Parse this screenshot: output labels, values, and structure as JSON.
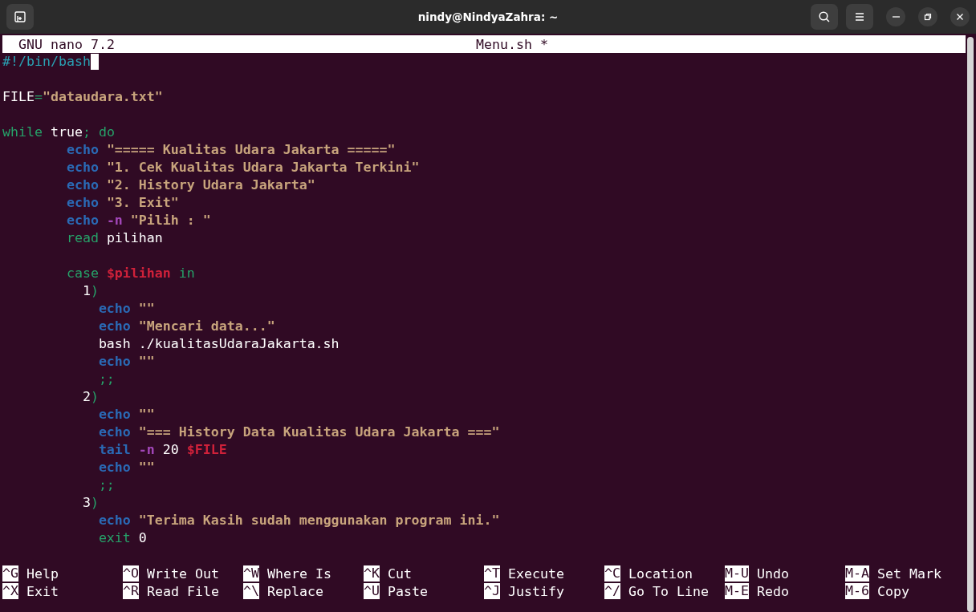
{
  "window": {
    "title": "nindy@NindyaZahra: ~"
  },
  "editor": {
    "app": "GNU nano 7.2",
    "filename": "Menu.sh *"
  },
  "lines": [
    {
      "cursor": true,
      "segments": [
        {
          "kind": "comment",
          "text": "#!/bin/bash"
        }
      ]
    },
    {
      "cursor": false
    },
    {
      "cursor": false,
      "segments": [
        {
          "kind": "plain",
          "text": "FILE"
        },
        {
          "kind": "punct",
          "text": "="
        },
        {
          "kind": "string",
          "text": "\"dataudara.txt\""
        }
      ]
    },
    {
      "cursor": false
    },
    {
      "cursor": false,
      "segments": [
        {
          "kind": "keyword",
          "text": "while"
        },
        {
          "kind": "plain",
          "text": " true"
        },
        {
          "kind": "keyword",
          "text": "; do"
        }
      ]
    },
    {
      "cursor": false,
      "segments": [
        {
          "kind": "builtin",
          "text": "        echo"
        },
        {
          "kind": "string",
          "text": " \"===== Kualitas Udara Jakarta =====\""
        }
      ]
    },
    {
      "cursor": false,
      "segments": [
        {
          "kind": "builtin",
          "text": "        echo"
        },
        {
          "kind": "string",
          "text": " \"1. Cek Kualitas Udara Jakarta Terkini\""
        }
      ]
    },
    {
      "cursor": false,
      "segments": [
        {
          "kind": "builtin",
          "text": "        echo"
        },
        {
          "kind": "string",
          "text": " \"2. History Udara Jakarta\""
        }
      ]
    },
    {
      "cursor": false,
      "segments": [
        {
          "kind": "builtin",
          "text": "        echo"
        },
        {
          "kind": "string",
          "text": " \"3. Exit\""
        }
      ]
    },
    {
      "cursor": false,
      "segments": [
        {
          "kind": "builtin",
          "text": "        echo"
        },
        {
          "kind": "option",
          "text": " -n"
        },
        {
          "kind": "string",
          "text": " \"Pilih : \""
        }
      ]
    },
    {
      "cursor": false,
      "segments": [
        {
          "kind": "keyword",
          "text": "        read"
        },
        {
          "kind": "plain",
          "text": " pilihan"
        }
      ]
    },
    {
      "cursor": false
    },
    {
      "cursor": false,
      "segments": [
        {
          "kind": "keyword",
          "text": "        case"
        },
        {
          "kind": "variable",
          "text": " $pilihan"
        },
        {
          "kind": "keyword",
          "text": " in"
        }
      ]
    },
    {
      "cursor": false,
      "segments": [
        {
          "kind": "plain",
          "text": "          1"
        },
        {
          "kind": "punct",
          "text": ")"
        }
      ]
    },
    {
      "cursor": false,
      "segments": [
        {
          "kind": "builtin",
          "text": "            echo"
        },
        {
          "kind": "string",
          "text": " \"\""
        }
      ]
    },
    {
      "cursor": false,
      "segments": [
        {
          "kind": "builtin",
          "text": "            echo"
        },
        {
          "kind": "string",
          "text": " \"Mencari data...\""
        }
      ]
    },
    {
      "cursor": false,
      "segments": [
        {
          "kind": "plain",
          "text": "            bash ./kualitasUdaraJakarta.sh"
        }
      ]
    },
    {
      "cursor": false,
      "segments": [
        {
          "kind": "builtin",
          "text": "            echo"
        },
        {
          "kind": "string",
          "text": " \"\""
        }
      ]
    },
    {
      "cursor": false,
      "segments": [
        {
          "kind": "punct",
          "text": "            ;;"
        }
      ]
    },
    {
      "cursor": false,
      "segments": [
        {
          "kind": "plain",
          "text": "          2"
        },
        {
          "kind": "punct",
          "text": ")"
        }
      ]
    },
    {
      "cursor": false,
      "segments": [
        {
          "kind": "builtin",
          "text": "            echo"
        },
        {
          "kind": "string",
          "text": " \"\""
        }
      ]
    },
    {
      "cursor": false,
      "segments": [
        {
          "kind": "builtin",
          "text": "            echo"
        },
        {
          "kind": "string",
          "text": " \"=== History Data Kualitas Udara Jakarta ===\""
        }
      ]
    },
    {
      "cursor": false,
      "segments": [
        {
          "kind": "builtin",
          "text": "            tail"
        },
        {
          "kind": "option",
          "text": " -n"
        },
        {
          "kind": "plain",
          "text": " 20"
        },
        {
          "kind": "variable",
          "text": " $FILE"
        }
      ]
    },
    {
      "cursor": false,
      "segments": [
        {
          "kind": "builtin",
          "text": "            echo"
        },
        {
          "kind": "string",
          "text": " \"\""
        }
      ]
    },
    {
      "cursor": false,
      "segments": [
        {
          "kind": "punct",
          "text": "            ;;"
        }
      ]
    },
    {
      "cursor": false,
      "segments": [
        {
          "kind": "plain",
          "text": "          3"
        },
        {
          "kind": "punct",
          "text": ")"
        }
      ]
    },
    {
      "cursor": false,
      "segments": [
        {
          "kind": "builtin",
          "text": "            echo"
        },
        {
          "kind": "string",
          "text": " \"Terima Kasih sudah menggunakan program ini.\""
        }
      ]
    },
    {
      "cursor": false,
      "segments": [
        {
          "kind": "keyword",
          "text": "            exit"
        },
        {
          "kind": "plain",
          "text": " 0"
        }
      ]
    }
  ],
  "shortcuts": [
    [
      {
        "key": "^G",
        "label": "Help"
      },
      {
        "key": "^X",
        "label": "Exit"
      }
    ],
    [
      {
        "key": "^O",
        "label": "Write Out"
      },
      {
        "key": "^R",
        "label": "Read File"
      }
    ],
    [
      {
        "key": "^W",
        "label": "Where Is"
      },
      {
        "key": "^\\",
        "label": "Replace"
      }
    ],
    [
      {
        "key": "^K",
        "label": "Cut"
      },
      {
        "key": "^U",
        "label": "Paste"
      }
    ],
    [
      {
        "key": "^T",
        "label": "Execute"
      },
      {
        "key": "^J",
        "label": "Justify"
      }
    ],
    [
      {
        "key": "^C",
        "label": "Location"
      },
      {
        "key": "^/",
        "label": "Go To Line"
      }
    ],
    [
      {
        "key": "M-U",
        "label": "Undo"
      },
      {
        "key": "M-E",
        "label": "Redo"
      }
    ],
    [
      {
        "key": "M-A",
        "label": "Set Mark"
      },
      {
        "key": "M-6",
        "label": "Copy"
      }
    ]
  ]
}
